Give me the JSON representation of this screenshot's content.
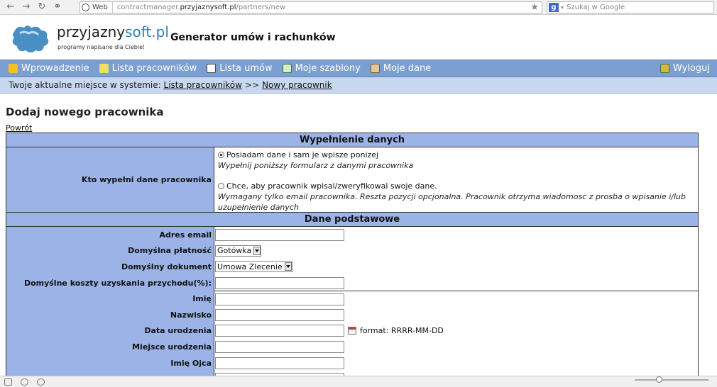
{
  "browser": {
    "badge": "Web",
    "url_prefix": "contractmanager.",
    "url_host": "przyjaznysoft.pl",
    "url_path": "/partners/new",
    "search_placeholder": "Szukaj w Google"
  },
  "header": {
    "logo_part1": "przyjazny",
    "logo_part2": "soft.pl",
    "tagline": "programy napisane dla Ciebie!",
    "title": "Generator umów i rachunków"
  },
  "menu": {
    "items": [
      {
        "label": "Wprowadzenie",
        "color": "#f2c020"
      },
      {
        "label": "Lista pracowników",
        "color": "#f0e060"
      },
      {
        "label": "Lista umów",
        "color": "#ffffff"
      },
      {
        "label": "Moje szablony",
        "color": "#d8ecd0"
      },
      {
        "label": "Moje dane",
        "color": "#e0c8a0"
      }
    ],
    "logout": "Wyloguj"
  },
  "breadcrumb": {
    "prefix": "Twoje aktualne miejsce w systemie:",
    "link1": "Lista pracowników",
    "separator": ">>",
    "link2": "Nowy pracownik"
  },
  "page": {
    "title": "Dodaj nowego pracownika",
    "back": "Powrót"
  },
  "form": {
    "section1": "Wypełnienie danych",
    "who_label": "Kto wypełni dane pracownika",
    "option1": "Posiadam dane i sam je wpisze ponizej",
    "option1_hint": "Wypełnij poniższy formularz z danymi pracownika",
    "option2": "Chce, aby pracownik wpisal/zweryfikowal swoje dane.",
    "option2_hint": "Wymagany tylko email pracownika. Reszta pozycji opcjonalna. Pracownik otrzyma wiadomosc z prosba o wpisanie i/lub uzupełnienie danych",
    "section2": "Dane podstawowe",
    "fields": {
      "email": "Adres email",
      "payment": "Domyślna płatność",
      "payment_value": "Gotówka",
      "document": "Domyślny dokument",
      "document_value": "Umowa Zlecenie",
      "costs": "Domyślne koszty uzyskania przychodu(%):",
      "first_name": "Imię",
      "last_name": "Nazwisko",
      "birth_date": "Data urodzenia",
      "date_format": "format: RRRR-MM-DD",
      "birth_place": "Miejsce urodzenia",
      "father_name": "Imię Ojca"
    }
  }
}
